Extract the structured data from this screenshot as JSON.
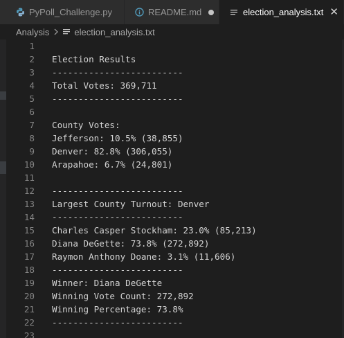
{
  "tabs": [
    {
      "label": "PyPoll_Challenge.py",
      "icon": "python-icon",
      "active": false
    },
    {
      "label": "README.md",
      "icon": "info-icon",
      "active": false,
      "modified": true
    },
    {
      "label": "election_analysis.txt",
      "icon": "text-file-icon",
      "active": true,
      "close": "✕"
    }
  ],
  "breadcrumb": {
    "folder": "Analysis",
    "file": "election_analysis.txt"
  },
  "editor": {
    "lines": [
      {
        "n": "1",
        "text": ""
      },
      {
        "n": "2",
        "text": "Election Results"
      },
      {
        "n": "3",
        "text": "-------------------------"
      },
      {
        "n": "4",
        "text": "Total Votes: 369,711"
      },
      {
        "n": "5",
        "text": "-------------------------"
      },
      {
        "n": "6",
        "text": ""
      },
      {
        "n": "7",
        "text": "County Votes:"
      },
      {
        "n": "8",
        "text": "Jefferson: 10.5% (38,855)"
      },
      {
        "n": "9",
        "text": "Denver: 82.8% (306,055)"
      },
      {
        "n": "10",
        "text": "Arapahoe: 6.7% (24,801)"
      },
      {
        "n": "11",
        "text": ""
      },
      {
        "n": "12",
        "text": "-------------------------"
      },
      {
        "n": "13",
        "text": "Largest County Turnout: Denver"
      },
      {
        "n": "14",
        "text": "-------------------------"
      },
      {
        "n": "15",
        "text": "Charles Casper Stockham: 23.0% (85,213)"
      },
      {
        "n": "16",
        "text": "Diana DeGette: 73.8% (272,892)"
      },
      {
        "n": "17",
        "text": "Raymon Anthony Doane: 3.1% (11,606)"
      },
      {
        "n": "18",
        "text": "-------------------------"
      },
      {
        "n": "19",
        "text": "Winner: Diana DeGette"
      },
      {
        "n": "20",
        "text": "Winning Vote Count: 272,892"
      },
      {
        "n": "21",
        "text": "Winning Percentage: 73.8%"
      },
      {
        "n": "22",
        "text": "-------------------------"
      },
      {
        "n": "23",
        "text": ""
      }
    ]
  },
  "colors": {
    "background": "#1e1e1e",
    "tab_inactive": "#2d2d2d",
    "text": "#d4d4d4",
    "line_number": "#858585",
    "python_icon": "#519aba",
    "info_icon": "#519aba"
  }
}
